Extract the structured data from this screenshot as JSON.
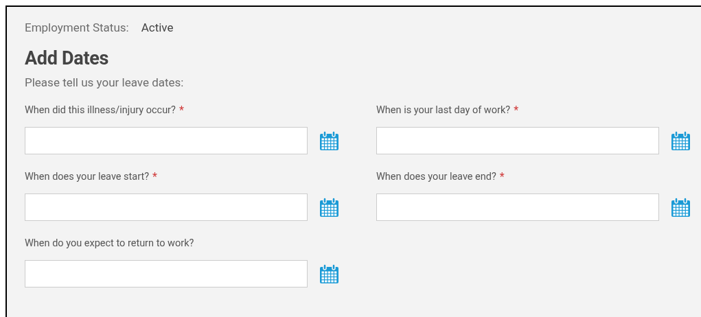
{
  "employment_status": {
    "label": "Employment Status:",
    "value": "Active"
  },
  "heading": "Add Dates",
  "instructions": "Please tell us your leave dates:",
  "date_fields": [
    {
      "label": "When did this illness/injury occur?",
      "required_mark": "*"
    },
    {
      "label": "When is your last day of work?",
      "required_mark": "*"
    },
    {
      "label": "When does your leave start?",
      "required_mark": "*"
    },
    {
      "label": "When does your leave end?",
      "required_mark": "*"
    },
    {
      "label": "When do you expect to return to work?"
    }
  ]
}
